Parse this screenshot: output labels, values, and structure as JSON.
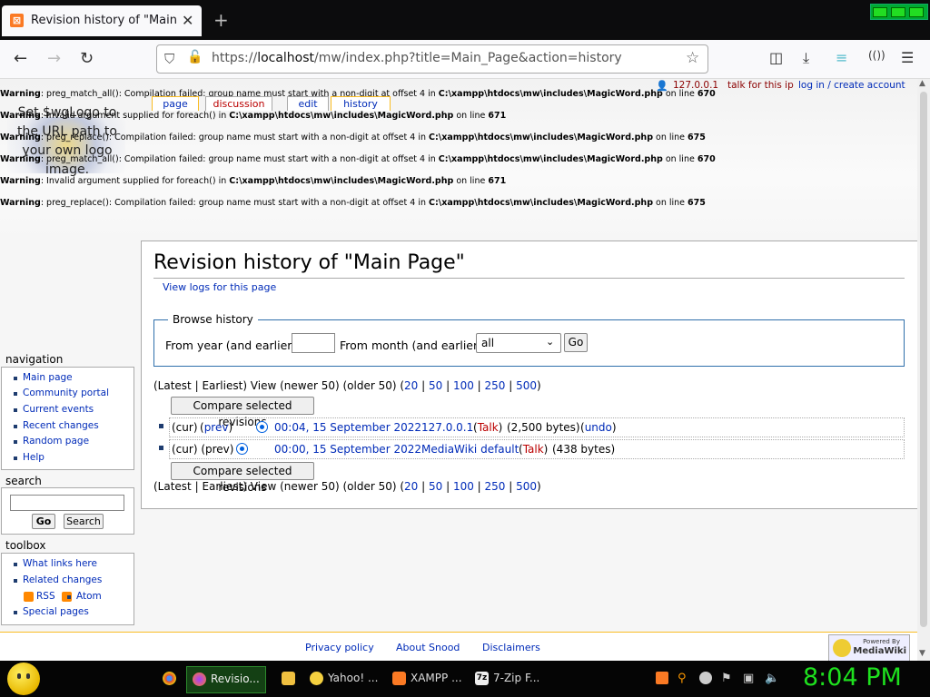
{
  "browser": {
    "tab_title": "Revision history of \"Main Page\"",
    "new_tab": "+",
    "url_prefix": "https://",
    "url_host": "localhost",
    "url_rest": "/mw/index.php?title=Main_Page&action=history"
  },
  "warnings": [
    {
      "label": "Warning",
      "text": ": preg_match_all(): Compilation failed: group name must start with a non-digit at offset 4 in ",
      "path": "C:\\xampp\\htdocs\\mw\\includes\\MagicWord.php",
      "tail": " on line ",
      "line": "670"
    },
    {
      "label": "Warning",
      "text": ": Invalid argument supplied for foreach() in ",
      "path": "C:\\xampp\\htdocs\\mw\\includes\\MagicWord.php",
      "tail": " on line ",
      "line": "671"
    },
    {
      "label": "Warning",
      "text": ": preg_replace(): Compilation failed: group name must start with a non-digit at offset 4 in ",
      "path": "C:\\xampp\\htdocs\\mw\\includes\\MagicWord.php",
      "tail": " on line ",
      "line": "675"
    },
    {
      "label": "Warning",
      "text": ": preg_match_all(): Compilation failed: group name must start with a non-digit at offset 4 in ",
      "path": "C:\\xampp\\htdocs\\mw\\includes\\MagicWord.php",
      "tail": " on line ",
      "line": "670"
    },
    {
      "label": "Warning",
      "text": ": Invalid argument supplied for foreach() in ",
      "path": "C:\\xampp\\htdocs\\mw\\includes\\MagicWord.php",
      "tail": " on line ",
      "line": "671"
    },
    {
      "label": "Warning",
      "text": ": preg_replace(): Compilation failed: group name must start with a non-digit at offset 4 in ",
      "path": "C:\\xampp\\htdocs\\mw\\includes\\MagicWord.php",
      "tail": " on line ",
      "line": "675"
    }
  ],
  "logo_text": "Set $wgLogo to the URL path to your own logo image.",
  "personal": {
    "ip": "127.0.0.1",
    "talk": "talk for this ip",
    "login": "log in / create account"
  },
  "content_tabs": {
    "page": "page",
    "discussion": "discussion",
    "edit": "edit",
    "history": "history"
  },
  "content": {
    "heading": "Revision history of \"Main Page\"",
    "view_logs": "View logs for this page",
    "browse_legend": "Browse history",
    "from_year": "From year (and earlier):",
    "from_month": "From month (and earlier):",
    "month_value": "all",
    "go": "Go",
    "compare_button": "Compare selected revisions",
    "pager": {
      "prefix": "(Latest | Earliest) View (newer 50) (older 50) (",
      "links": [
        "20",
        "50",
        "100",
        "250",
        "500"
      ],
      "sep": " | ",
      "suffix": ")"
    },
    "history": [
      {
        "cur": "(cur)",
        "prev": "prev",
        "date": "00:04, 15 September 2022",
        "user": "127.0.0.1",
        "talk": "Talk",
        "size": "(2,500 bytes)",
        "undo": "undo"
      },
      {
        "cur": "(cur) (prev)",
        "date": "00:00, 15 September 2022",
        "user": "MediaWiki default",
        "talk": "Talk",
        "size": "(438 bytes)"
      }
    ]
  },
  "sidebar": {
    "navigation": {
      "title": "navigation",
      "items": [
        "Main page",
        "Community portal",
        "Current events",
        "Recent changes",
        "Random page",
        "Help"
      ]
    },
    "search": {
      "title": "search",
      "go": "Go",
      "search": "Search"
    },
    "toolbox": {
      "title": "toolbox",
      "items": [
        "What links here",
        "Related changes"
      ],
      "rss": "RSS",
      "atom": "Atom",
      "special": "Special pages"
    }
  },
  "footer": {
    "privacy": "Privacy policy",
    "about": "About Snood",
    "disclaimers": "Disclaimers",
    "powered_top": "Powered By",
    "powered_bottom": "MediaWiki"
  },
  "taskbar": {
    "items": [
      "Revisio...",
      "Yahoo! ...",
      "XAMPP ...",
      "7-Zip F..."
    ],
    "clock": "8:04 PM"
  },
  "colors": {
    "link": "#002bb8",
    "redlink": "#b00",
    "clock": "#1ee01e",
    "active_tab_border": "#fabd23"
  }
}
